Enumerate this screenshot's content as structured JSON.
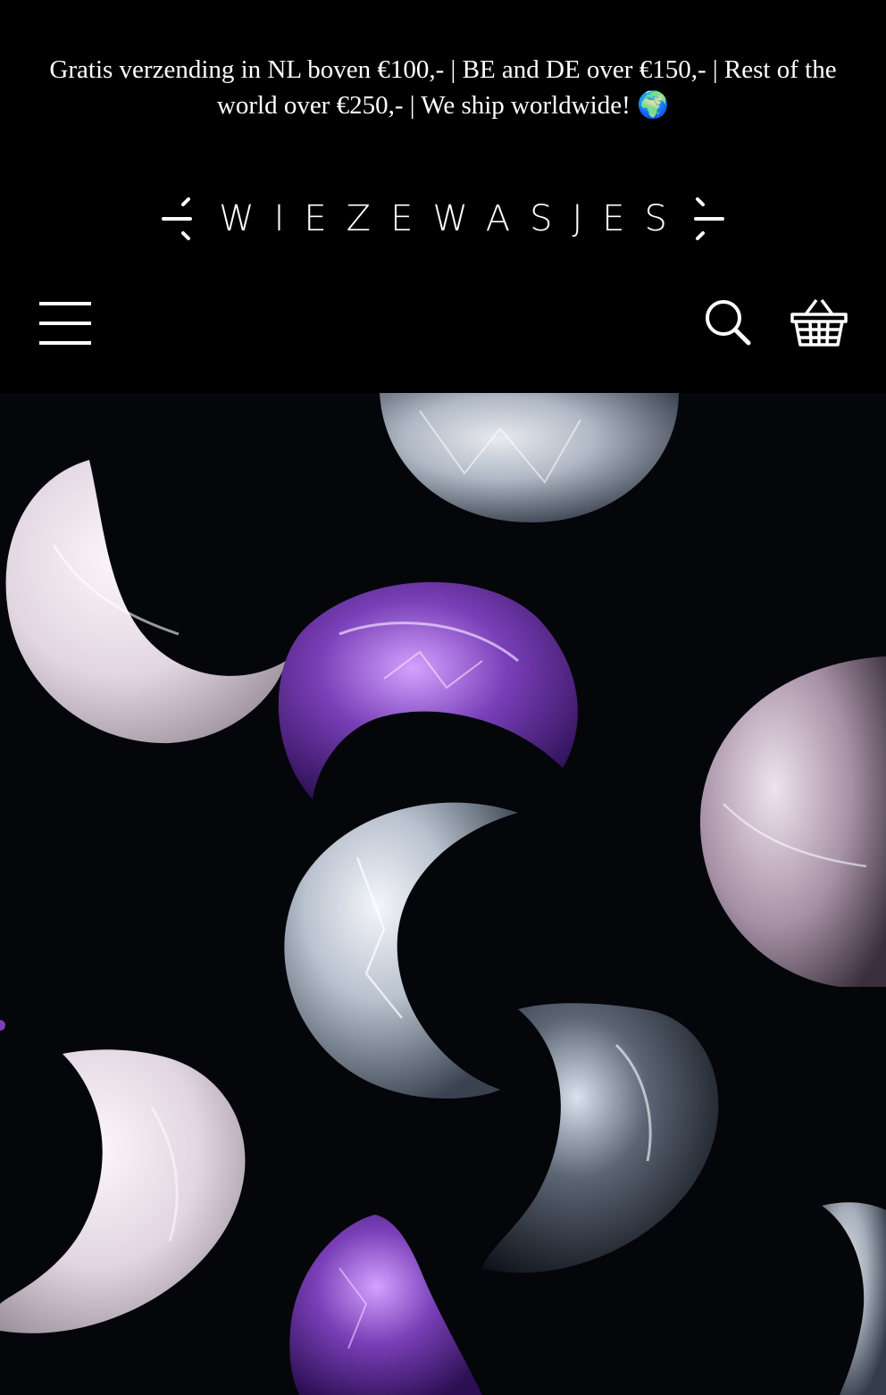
{
  "announcement": {
    "text": "Gratis verzending in NL boven €100,- | BE and DE over €150,- | Rest of the world over €250,- | We ship worldwide! 🌍"
  },
  "header": {
    "logo_text": "WIEZEWASJES",
    "menu_icon": "hamburger-menu-icon",
    "search_icon": "search-icon",
    "cart_icon": "basket-icon"
  },
  "colors": {
    "background": "#000000",
    "text": "#ffffff",
    "amethyst": "#7a3fb8",
    "rose_quartz": "#e9dde6",
    "clear_quartz": "#cfd6df"
  }
}
